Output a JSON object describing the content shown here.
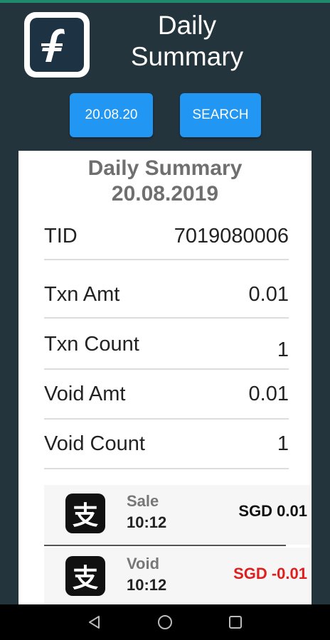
{
  "header": {
    "title": "Daily\nSummary",
    "logo_icon": "fave-logo-icon"
  },
  "controls": {
    "date_button": "20.08.20",
    "search_button": "SEARCH"
  },
  "summary": {
    "title": "Daily Summary",
    "date": "20.08.2019",
    "rows": [
      {
        "label": "TID",
        "value": "7019080006"
      },
      {
        "label": "Txn Amt",
        "value": "0.01"
      },
      {
        "label": "Txn Count",
        "value": "1"
      },
      {
        "label": "Void Amt",
        "value": "0.01"
      },
      {
        "label": "Void Count",
        "value": "1"
      }
    ]
  },
  "transactions": [
    {
      "icon": "alipay-icon",
      "type": "Sale",
      "time": "10:12",
      "amount": "SGD 0.01",
      "amount_color": "#111111"
    },
    {
      "icon": "alipay-icon",
      "type": "Void",
      "time": "10:12",
      "amount": "SGD -0.01",
      "amount_color": "#e01e1e"
    }
  ],
  "navbar": {
    "icons": [
      "back-icon",
      "home-icon",
      "recents-icon"
    ]
  },
  "colors": {
    "background": "#24343d",
    "accent": "#2196f3",
    "void_red": "#e01e1e"
  }
}
